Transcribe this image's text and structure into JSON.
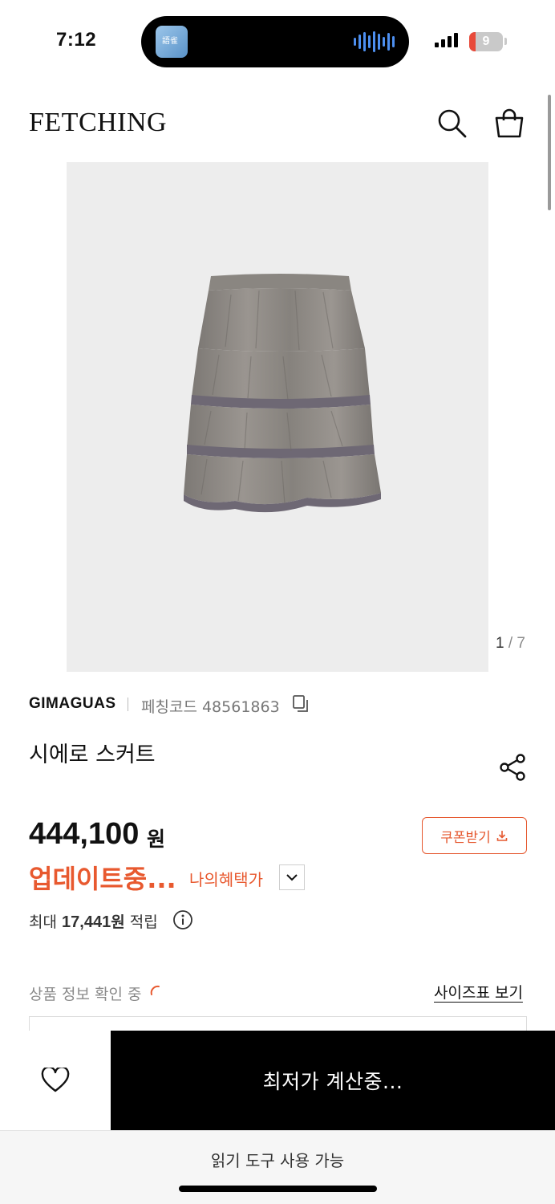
{
  "status_bar": {
    "time": "7:12",
    "battery_level": "9",
    "island_thumb_text": "語雀",
    "icons": [
      "signal-icon",
      "battery-icon",
      "audio-wave-icon"
    ]
  },
  "header": {
    "logo": "FETCHING",
    "icons": [
      "search-icon",
      "shopping-bag-icon"
    ]
  },
  "gallery": {
    "current": "1",
    "separator": "/",
    "total": "7"
  },
  "product": {
    "brand": "GIMAGUAS",
    "code_label": "페칭코드 48561863",
    "name": "시에로 스커트",
    "price": "444,100",
    "price_unit": "원",
    "coupon_label": "쿠폰받기",
    "updating_label": "업데이트중...",
    "benefit_label": "나의혜택가",
    "points_prefix": "최대",
    "points_value": "17,441",
    "points_unit": "원",
    "points_suffix": "적립",
    "checking_label": "상품 정보 확인 중",
    "size_chart_label": "사이즈표 보기"
  },
  "bottom_bar": {
    "cta_label": "최저가 계산중...",
    "reader_label": "읽기 도구 사용 가능"
  },
  "colors": {
    "accent": "#e8592f",
    "cta_background": "#000000",
    "image_background": "#ededed"
  }
}
